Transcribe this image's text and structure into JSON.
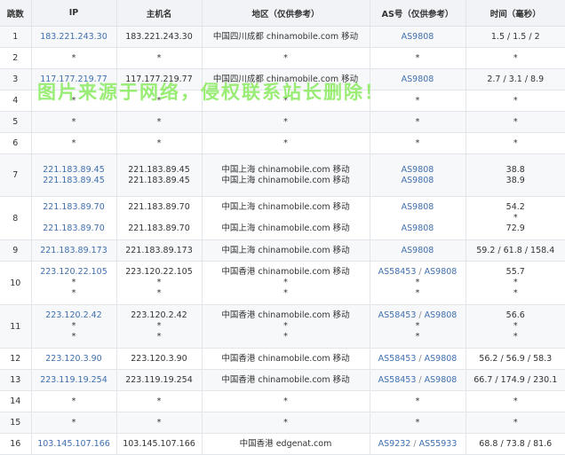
{
  "headers": [
    "跳数",
    "IP",
    "主机名",
    "地区（仅供参考）",
    "AS号（仅供参考）",
    "时间（毫秒）"
  ],
  "watermark": "图片来源于网络，侵权联系站长删除！",
  "rows": [
    {
      "hop": "1",
      "lines": [
        {
          "ip": "183.221.243.30",
          "host": "183.221.243.30",
          "region": "中国四川成都 chinamobile.com 移动",
          "as": [
            "AS9808"
          ],
          "time": "1.5 / 1.5 / 2"
        }
      ]
    },
    {
      "hop": "2",
      "lines": [
        {
          "ip": "*",
          "host": "*",
          "region": "*",
          "as": [
            "*"
          ],
          "time": "*"
        }
      ]
    },
    {
      "hop": "3",
      "lines": [
        {
          "ip": "117.177.219.77",
          "host": "117.177.219.77",
          "region": "中国四川成都 chinamobile.com 移动",
          "as": [
            "AS9808"
          ],
          "time": "2.7 / 3.1 / 8.9"
        }
      ]
    },
    {
      "hop": "4",
      "lines": [
        {
          "ip": "*",
          "host": "*",
          "region": "*",
          "as": [
            "*"
          ],
          "time": "*"
        }
      ]
    },
    {
      "hop": "5",
      "lines": [
        {
          "ip": "*",
          "host": "*",
          "region": "*",
          "as": [
            "*"
          ],
          "time": "*"
        }
      ]
    },
    {
      "hop": "6",
      "lines": [
        {
          "ip": "*",
          "host": "*",
          "region": "*",
          "as": [
            "*"
          ],
          "time": "*"
        }
      ]
    },
    {
      "hop": "7",
      "lines": [
        {
          "ip": "221.183.89.45",
          "host": "221.183.89.45",
          "region": "中国上海 chinamobile.com 移动",
          "as": [
            "AS9808"
          ],
          "time": "38.8"
        },
        {
          "ip": "221.183.89.45",
          "host": "221.183.89.45",
          "region": "中国上海 chinamobile.com 移动",
          "as": [
            "AS9808"
          ],
          "time": "38.9"
        }
      ]
    },
    {
      "hop": "8",
      "lines": [
        {
          "ip": "221.183.89.70",
          "host": "221.183.89.70",
          "region": "中国上海 chinamobile.com 移动",
          "as": [
            "AS9808"
          ],
          "time": "54.2"
        },
        {
          "ip": "",
          "host": "",
          "region": "",
          "as": [],
          "time": "*"
        },
        {
          "ip": "221.183.89.70",
          "host": "221.183.89.70",
          "region": "中国上海 chinamobile.com 移动",
          "as": [
            "AS9808"
          ],
          "time": "72.9"
        }
      ]
    },
    {
      "hop": "9",
      "lines": [
        {
          "ip": "221.183.89.173",
          "host": "221.183.89.173",
          "region": "中国上海 chinamobile.com 移动",
          "as": [
            "AS9808"
          ],
          "time": "59.2 / 61.8 / 158.4"
        }
      ]
    },
    {
      "hop": "10",
      "lines": [
        {
          "ip": "223.120.22.105",
          "host": "223.120.22.105",
          "region": "中国香港 chinamobile.com 移动",
          "as": [
            "AS58453",
            "AS9808"
          ],
          "time": "55.7"
        },
        {
          "ip": "*",
          "host": "*",
          "region": "*",
          "as": [
            "*"
          ],
          "time": "*"
        },
        {
          "ip": "*",
          "host": "*",
          "region": "*",
          "as": [
            "*"
          ],
          "time": "*"
        }
      ]
    },
    {
      "hop": "11",
      "lines": [
        {
          "ip": "223.120.2.42",
          "host": "223.120.2.42",
          "region": "中国香港 chinamobile.com 移动",
          "as": [
            "AS58453",
            "AS9808"
          ],
          "time": "56.6"
        },
        {
          "ip": "*",
          "host": "*",
          "region": "*",
          "as": [
            "*"
          ],
          "time": "*"
        },
        {
          "ip": "*",
          "host": "*",
          "region": "*",
          "as": [
            "*"
          ],
          "time": "*"
        }
      ]
    },
    {
      "hop": "12",
      "lines": [
        {
          "ip": "223.120.3.90",
          "host": "223.120.3.90",
          "region": "中国香港 chinamobile.com 移动",
          "as": [
            "AS58453",
            "AS9808"
          ],
          "time": "56.2 / 56.9 / 58.3"
        }
      ]
    },
    {
      "hop": "13",
      "lines": [
        {
          "ip": "223.119.19.254",
          "host": "223.119.19.254",
          "region": "中国香港 chinamobile.com 移动",
          "as": [
            "AS58453",
            "AS9808"
          ],
          "time": "66.7 / 174.9 / 230.1"
        }
      ]
    },
    {
      "hop": "14",
      "lines": [
        {
          "ip": "*",
          "host": "*",
          "region": "*",
          "as": [
            "*"
          ],
          "time": "*"
        }
      ]
    },
    {
      "hop": "15",
      "lines": [
        {
          "ip": "*",
          "host": "*",
          "region": "*",
          "as": [
            "*"
          ],
          "time": "*"
        }
      ]
    },
    {
      "hop": "16",
      "lines": [
        {
          "ip": "103.145.107.166",
          "host": "103.145.107.166",
          "region": "中国香港 edgenat.com",
          "as": [
            "AS9232",
            "AS55933"
          ],
          "time": "68.8 / 73.8 / 81.6"
        }
      ]
    }
  ]
}
